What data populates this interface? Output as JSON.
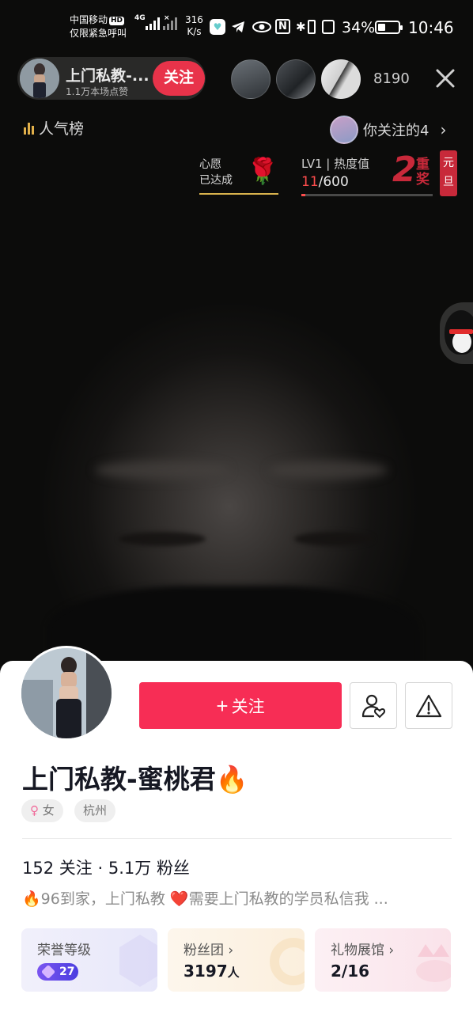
{
  "status_bar": {
    "carrier_line1": "中国移动",
    "carrier_hd": "HD",
    "carrier_line2": "仅限紧急呼叫",
    "network_type": "4G",
    "net_speed_value": "316",
    "net_speed_unit": "K/s",
    "battery_percent": "34%",
    "battery_level": 0.34,
    "time": "10:46"
  },
  "live_header": {
    "host_name": "上门私教-...",
    "host_likes": "1.1万本场点赞",
    "follow_label": "关注",
    "viewer_count": "8190",
    "ranking_label": "人气榜",
    "followed_label": "你关注的4"
  },
  "wish": {
    "line1": "心愿",
    "line2": "已达成"
  },
  "heat": {
    "level": "LV1",
    "title": "热度值",
    "current": "11",
    "total": "/600",
    "progress": 0.018
  },
  "event_badge": {
    "number": "2",
    "text": "重奖",
    "side": "元旦"
  },
  "profile": {
    "follow_button": "关注",
    "name": "上门私教-蜜桃君",
    "name_emoji": "🔥",
    "gender_symbol": "♀",
    "gender": "女",
    "city": "杭州",
    "following_count": "152",
    "following_label": "关注",
    "separator": "·",
    "followers_count": "5.1万",
    "followers_label": "粉丝",
    "bio_emoji": "🔥",
    "bio_text": "96到家，上门私教",
    "bio_heart": "❤️",
    "bio_text2": "需要上门私教的学员私信我 ..."
  },
  "cards": {
    "honor_title": "荣誉等级",
    "honor_level": "27",
    "fans_title": "粉丝团 ›",
    "fans_value": "3197",
    "fans_unit": "人",
    "gift_title": "礼物展馆 ›",
    "gift_value": "2/16"
  },
  "colors": {
    "follow_red": "#f72d55",
    "header_follow_red": "#e8334a",
    "heat_red": "#ff4d4d",
    "ranking_gold": "#e1b04a",
    "honor_purple": "#5c45e6"
  }
}
